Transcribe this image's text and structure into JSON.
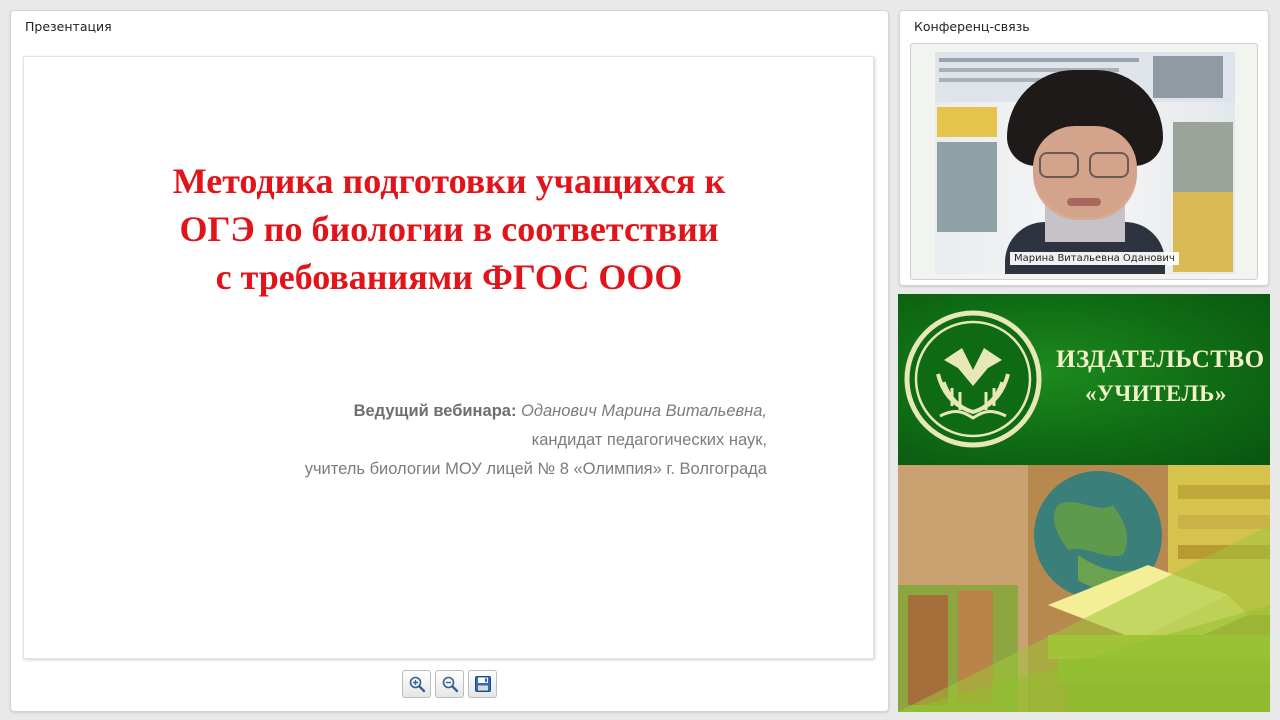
{
  "presentation": {
    "panel_title": "Презентация",
    "slide": {
      "title_lines": [
        "Методика подготовки учащихся к",
        "ОГЭ по биологии в соответствии",
        "с требованиями ФГОС ООО"
      ],
      "host_label": "Ведущий вебинара:",
      "host_name": "Оданович Марина Витальевна,",
      "host_degree": "кандидат педагогических наук,",
      "host_position": "учитель биологии МОУ лицей № 8 «Олимпия» г. Волгограда"
    },
    "toolbar": [
      {
        "icon": "zoom-in-icon"
      },
      {
        "icon": "zoom-out-icon"
      },
      {
        "icon": "save-icon"
      }
    ]
  },
  "conference": {
    "panel_title": "Конференц-связь",
    "participant_name": "Марина Витальевна Оданович"
  },
  "ad": {
    "line1": "ИЗДАТЕЛЬСТВО",
    "line2": "«УЧИТЕЛЬ»"
  },
  "colors": {
    "slide_title": "#e1141a",
    "ad_green": "#0f6b14",
    "ad_text": "#f1f0c8"
  }
}
